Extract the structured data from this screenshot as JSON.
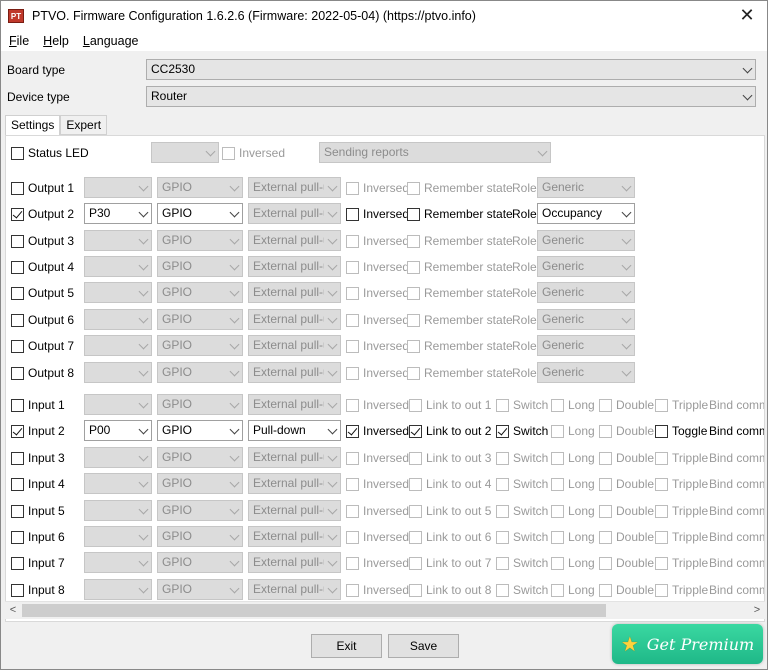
{
  "window": {
    "title": "PTVO. Firmware Configuration 1.6.2.6 (Firmware: 2022-05-04) (https://ptvo.info)",
    "icon_label": "PT",
    "close_glyph": "✕"
  },
  "menu": [
    "File",
    "Help",
    "Language"
  ],
  "board": {
    "label": "Board type",
    "value": "CC2530"
  },
  "device": {
    "label": "Device type",
    "value": "Router"
  },
  "tabs": [
    "Settings",
    "Expert"
  ],
  "status_led": {
    "label": "Status LED",
    "pin": "",
    "inversed": "Inversed",
    "reports": "Sending reports"
  },
  "outputs": [
    {
      "label": "Output 1",
      "checked": false,
      "pin": "",
      "mode": "GPIO",
      "pull": "External pull-up",
      "inversed": "Inversed",
      "inversed_checked": false,
      "remember": "Remember state",
      "remember_checked": false,
      "role_label": "Role",
      "role": "Generic"
    },
    {
      "label": "Output 2",
      "checked": true,
      "pin": "P30",
      "mode": "GPIO",
      "pull": "External pull-up",
      "inversed": "Inversed",
      "inversed_checked": false,
      "remember": "Remember state",
      "remember_checked": false,
      "role_label": "Role",
      "role": "Occupancy"
    },
    {
      "label": "Output 3",
      "checked": false,
      "pin": "",
      "mode": "GPIO",
      "pull": "External pull-up",
      "inversed": "Inversed",
      "inversed_checked": false,
      "remember": "Remember state",
      "remember_checked": false,
      "role_label": "Role",
      "role": "Generic"
    },
    {
      "label": "Output 4",
      "checked": false,
      "pin": "",
      "mode": "GPIO",
      "pull": "External pull-up",
      "inversed": "Inversed",
      "inversed_checked": false,
      "remember": "Remember state",
      "remember_checked": false,
      "role_label": "Role",
      "role": "Generic"
    },
    {
      "label": "Output 5",
      "checked": false,
      "pin": "",
      "mode": "GPIO",
      "pull": "External pull-up",
      "inversed": "Inversed",
      "inversed_checked": false,
      "remember": "Remember state",
      "remember_checked": false,
      "role_label": "Role",
      "role": "Generic"
    },
    {
      "label": "Output 6",
      "checked": false,
      "pin": "",
      "mode": "GPIO",
      "pull": "External pull-up",
      "inversed": "Inversed",
      "inversed_checked": false,
      "remember": "Remember state",
      "remember_checked": false,
      "role_label": "Role",
      "role": "Generic"
    },
    {
      "label": "Output 7",
      "checked": false,
      "pin": "",
      "mode": "GPIO",
      "pull": "External pull-up",
      "inversed": "Inversed",
      "inversed_checked": false,
      "remember": "Remember state",
      "remember_checked": false,
      "role_label": "Role",
      "role": "Generic"
    },
    {
      "label": "Output 8",
      "checked": false,
      "pin": "",
      "mode": "GPIO",
      "pull": "External pull-up",
      "inversed": "Inversed",
      "inversed_checked": false,
      "remember": "Remember state",
      "remember_checked": false,
      "role_label": "Role",
      "role": "Generic"
    }
  ],
  "inputs": [
    {
      "label": "Input 1",
      "checked": false,
      "pin": "",
      "mode": "GPIO",
      "pull": "External pull-up",
      "inversed": "Inversed",
      "inversed_checked": false,
      "link": "Link to out 1",
      "link_checked": false,
      "switch": "Switch",
      "switch_checked": false,
      "long": "Long",
      "double": "Double",
      "tripple": "Tripple",
      "toggle": "",
      "bind": "Bind comma"
    },
    {
      "label": "Input 2",
      "checked": true,
      "pin": "P00",
      "mode": "GPIO",
      "pull": "Pull-down",
      "inversed": "Inversed",
      "inversed_checked": true,
      "link": "Link to out 2",
      "link_checked": true,
      "switch": "Switch",
      "switch_checked": true,
      "long": "Long",
      "double": "Double",
      "tripple": "",
      "toggle": "Toggle",
      "bind": "Bind comma"
    },
    {
      "label": "Input 3",
      "checked": false,
      "pin": "",
      "mode": "GPIO",
      "pull": "External pull-up",
      "inversed": "Inversed",
      "inversed_checked": false,
      "link": "Link to out 3",
      "link_checked": false,
      "switch": "Switch",
      "switch_checked": false,
      "long": "Long",
      "double": "Double",
      "tripple": "Tripple",
      "toggle": "",
      "bind": "Bind comma"
    },
    {
      "label": "Input 4",
      "checked": false,
      "pin": "",
      "mode": "GPIO",
      "pull": "External pull-up",
      "inversed": "Inversed",
      "inversed_checked": false,
      "link": "Link to out 4",
      "link_checked": false,
      "switch": "Switch",
      "switch_checked": false,
      "long": "Long",
      "double": "Double",
      "tripple": "Tripple",
      "toggle": "",
      "bind": "Bind comma"
    },
    {
      "label": "Input 5",
      "checked": false,
      "pin": "",
      "mode": "GPIO",
      "pull": "External pull-up",
      "inversed": "Inversed",
      "inversed_checked": false,
      "link": "Link to out 5",
      "link_checked": false,
      "switch": "Switch",
      "switch_checked": false,
      "long": "Long",
      "double": "Double",
      "tripple": "Tripple",
      "toggle": "",
      "bind": "Bind comma"
    },
    {
      "label": "Input 6",
      "checked": false,
      "pin": "",
      "mode": "GPIO",
      "pull": "External pull-up",
      "inversed": "Inversed",
      "inversed_checked": false,
      "link": "Link to out 6",
      "link_checked": false,
      "switch": "Switch",
      "switch_checked": false,
      "long": "Long",
      "double": "Double",
      "tripple": "Tripple",
      "toggle": "",
      "bind": "Bind comma"
    },
    {
      "label": "Input 7",
      "checked": false,
      "pin": "",
      "mode": "GPIO",
      "pull": "External pull-up",
      "inversed": "Inversed",
      "inversed_checked": false,
      "link": "Link to out 7",
      "link_checked": false,
      "switch": "Switch",
      "switch_checked": false,
      "long": "Long",
      "double": "Double",
      "tripple": "Tripple",
      "toggle": "",
      "bind": "Bind comma"
    },
    {
      "label": "Input 8",
      "checked": false,
      "pin": "",
      "mode": "GPIO",
      "pull": "External pull-up",
      "inversed": "Inversed",
      "inversed_checked": false,
      "link": "Link to out 8",
      "link_checked": false,
      "switch": "Switch",
      "switch_checked": false,
      "long": "Long",
      "double": "Double",
      "tripple": "Tripple",
      "toggle": "",
      "bind": "Bind comma"
    }
  ],
  "footer": {
    "exit": "Exit",
    "save": "Save",
    "premium": "Get Premium",
    "scroll_left": "<",
    "scroll_right": ">"
  }
}
